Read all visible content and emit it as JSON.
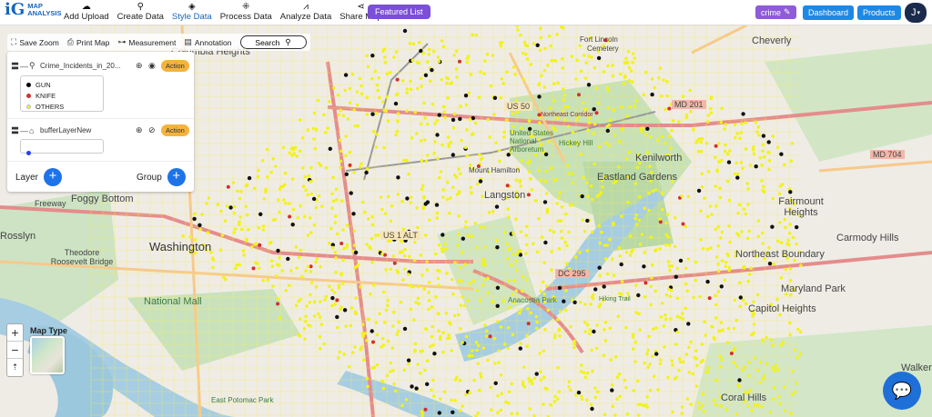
{
  "app": {
    "logo_mark": "iG",
    "logo_line1": "MAP",
    "logo_line2": "ANALYSIS"
  },
  "nav": [
    {
      "label": "Add Upload",
      "icon": "cloud-upload-icon",
      "glyph": "☁"
    },
    {
      "label": "Create Data",
      "icon": "map-pin-icon",
      "glyph": "⚲"
    },
    {
      "label": "Style Data",
      "icon": "paint-bucket-icon",
      "glyph": "◈",
      "active": true
    },
    {
      "label": "Process Data",
      "icon": "process-icon",
      "glyph": "⁜"
    },
    {
      "label": "Analyze Data",
      "icon": "analyze-icon",
      "glyph": "⩘"
    },
    {
      "label": "Share Map",
      "icon": "share-icon",
      "glyph": "⋖"
    }
  ],
  "header": {
    "featured": "Featured List",
    "crime_chip": "crime",
    "dashboard": "Dashboard",
    "products": "Products",
    "avatar_initial": "J"
  },
  "map_tools": {
    "save_zoom": "Save Zoom",
    "print_map": "Print Map",
    "measurement": "Measurement",
    "annotation": "Annotation",
    "search": "Search"
  },
  "layers": [
    {
      "name": "Crime_Incidents_in_20...",
      "action": "Action",
      "legend": [
        {
          "label": "GUN",
          "color": "#000000"
        },
        {
          "label": "KNIFE",
          "color": "#d32f2f"
        },
        {
          "label": "OTHERS",
          "color": "#f2f21c"
        }
      ]
    },
    {
      "name": "bufferLayerNew",
      "action": "Action",
      "legend_color": "#2b3ef0"
    }
  ],
  "panel": {
    "layer_label": "Layer",
    "group_label": "Group"
  },
  "map_controls": {
    "zoom_in": "+",
    "zoom_out": "−",
    "reset": "⇡",
    "map_type_label": "Map Type"
  },
  "map_labels": {
    "columbia_heights": "Columbia Heights",
    "fort_lincoln": "Fort Lincoln",
    "fort_lincoln_cemetery": "Cemetery",
    "cheverly": "Cheverly",
    "us50": "US 50",
    "northeast_corridor": "Northeast Corridor",
    "md201": "MD 201",
    "md704": "MD 704",
    "usna": "United States National Arboretum",
    "hickey_hill": "Hickey Hill",
    "kenilworth": "Kenilworth",
    "eastland_gardens": "Eastland Gardens",
    "mount_hamilton": "Mount Hamilton",
    "langston": "Langston",
    "fairmount_heights": "Fairmount Heights",
    "carmody_hills": "Carmody Hills",
    "northeast_boundary": "Northeast Boundary",
    "washington": "Washington",
    "theodore_roosevelt_bridge": "Theodore Roosevelt Bridge",
    "rosslyn": "Rosslyn",
    "foggy_bottom": "Foggy Bottom",
    "freeway": "Freeway",
    "national_mall": "National Mall",
    "us1_alt": "US 1 ALT",
    "dc295": "DC 295",
    "maryland_park": "Maryland Park",
    "capitol_heights": "Capitol Heights",
    "anacostia_park": "Anacostia Park",
    "east_potomac_park": "East Potomac Park",
    "walker_mill": "Walker M",
    "coral_hills": "Coral Hills",
    "hiking_trail": "Hiking Trail"
  }
}
